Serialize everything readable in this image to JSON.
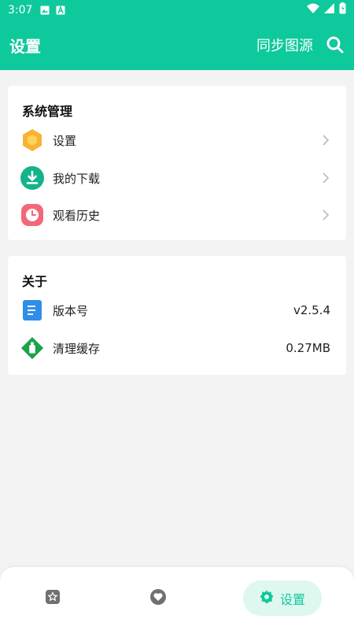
{
  "status_bar": {
    "time": "3:07"
  },
  "app_bar": {
    "title": "设置",
    "sync_label": "同步图源"
  },
  "system": {
    "title": "系统管理",
    "items": [
      {
        "label": "设置",
        "icon": "hexagon-settings-icon"
      },
      {
        "label": "我的下载",
        "icon": "download-icon"
      },
      {
        "label": "观看历史",
        "icon": "clock-icon"
      }
    ]
  },
  "about": {
    "title": "关于",
    "items": [
      {
        "label": "版本号",
        "value": "v2.5.4",
        "icon": "document-icon"
      },
      {
        "label": "清理缓存",
        "value": "0.27MB",
        "icon": "broom-icon"
      }
    ]
  },
  "bottom_nav": {
    "settings_label": "设置"
  },
  "colors": {
    "accent": "#0ec99c",
    "background": "#f3f3f3",
    "nav_pill": "#def7ef"
  }
}
